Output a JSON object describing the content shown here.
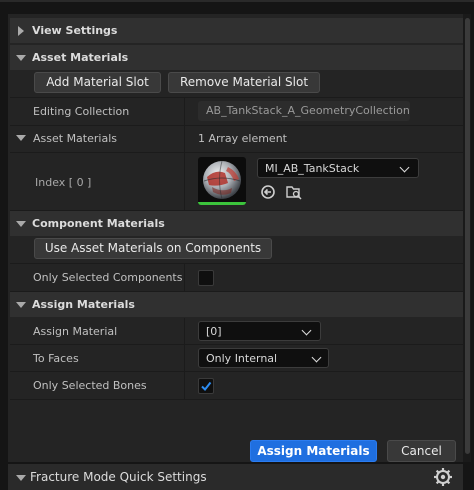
{
  "sections": {
    "view_settings": "View Settings",
    "asset_materials": "Asset Materials",
    "component_materials": "Component Materials",
    "assign_materials": "Assign Materials"
  },
  "asset_materials": {
    "add_slot_label": "Add Material Slot",
    "remove_slot_label": "Remove Material Slot",
    "editing_collection_label": "Editing Collection",
    "editing_collection_value": "AB_TankStack_A_GeometryCollection",
    "array_label": "Asset Materials",
    "array_count": "1 Array element",
    "index_label": "Index [ 0 ]",
    "material_value": "MI_AB_TankStack"
  },
  "component_materials": {
    "use_asset_button": "Use Asset Materials on Components",
    "only_selected_label": "Only Selected Components",
    "only_selected_checked": false
  },
  "assign_materials": {
    "assign_material_label": "Assign Material",
    "assign_material_value": "[0]",
    "to_faces_label": "To Faces",
    "to_faces_value": "Only Internal Faces",
    "only_selected_bones_label": "Only Selected Bones",
    "only_selected_bones_checked": true
  },
  "footer": {
    "assign_button": "Assign Materials",
    "cancel_button": "Cancel",
    "quick_settings_label": "Fracture Mode Quick Settings"
  },
  "colors": {
    "accent": "#1f6fe0",
    "thumbnail_underline": "#3cc43c"
  }
}
